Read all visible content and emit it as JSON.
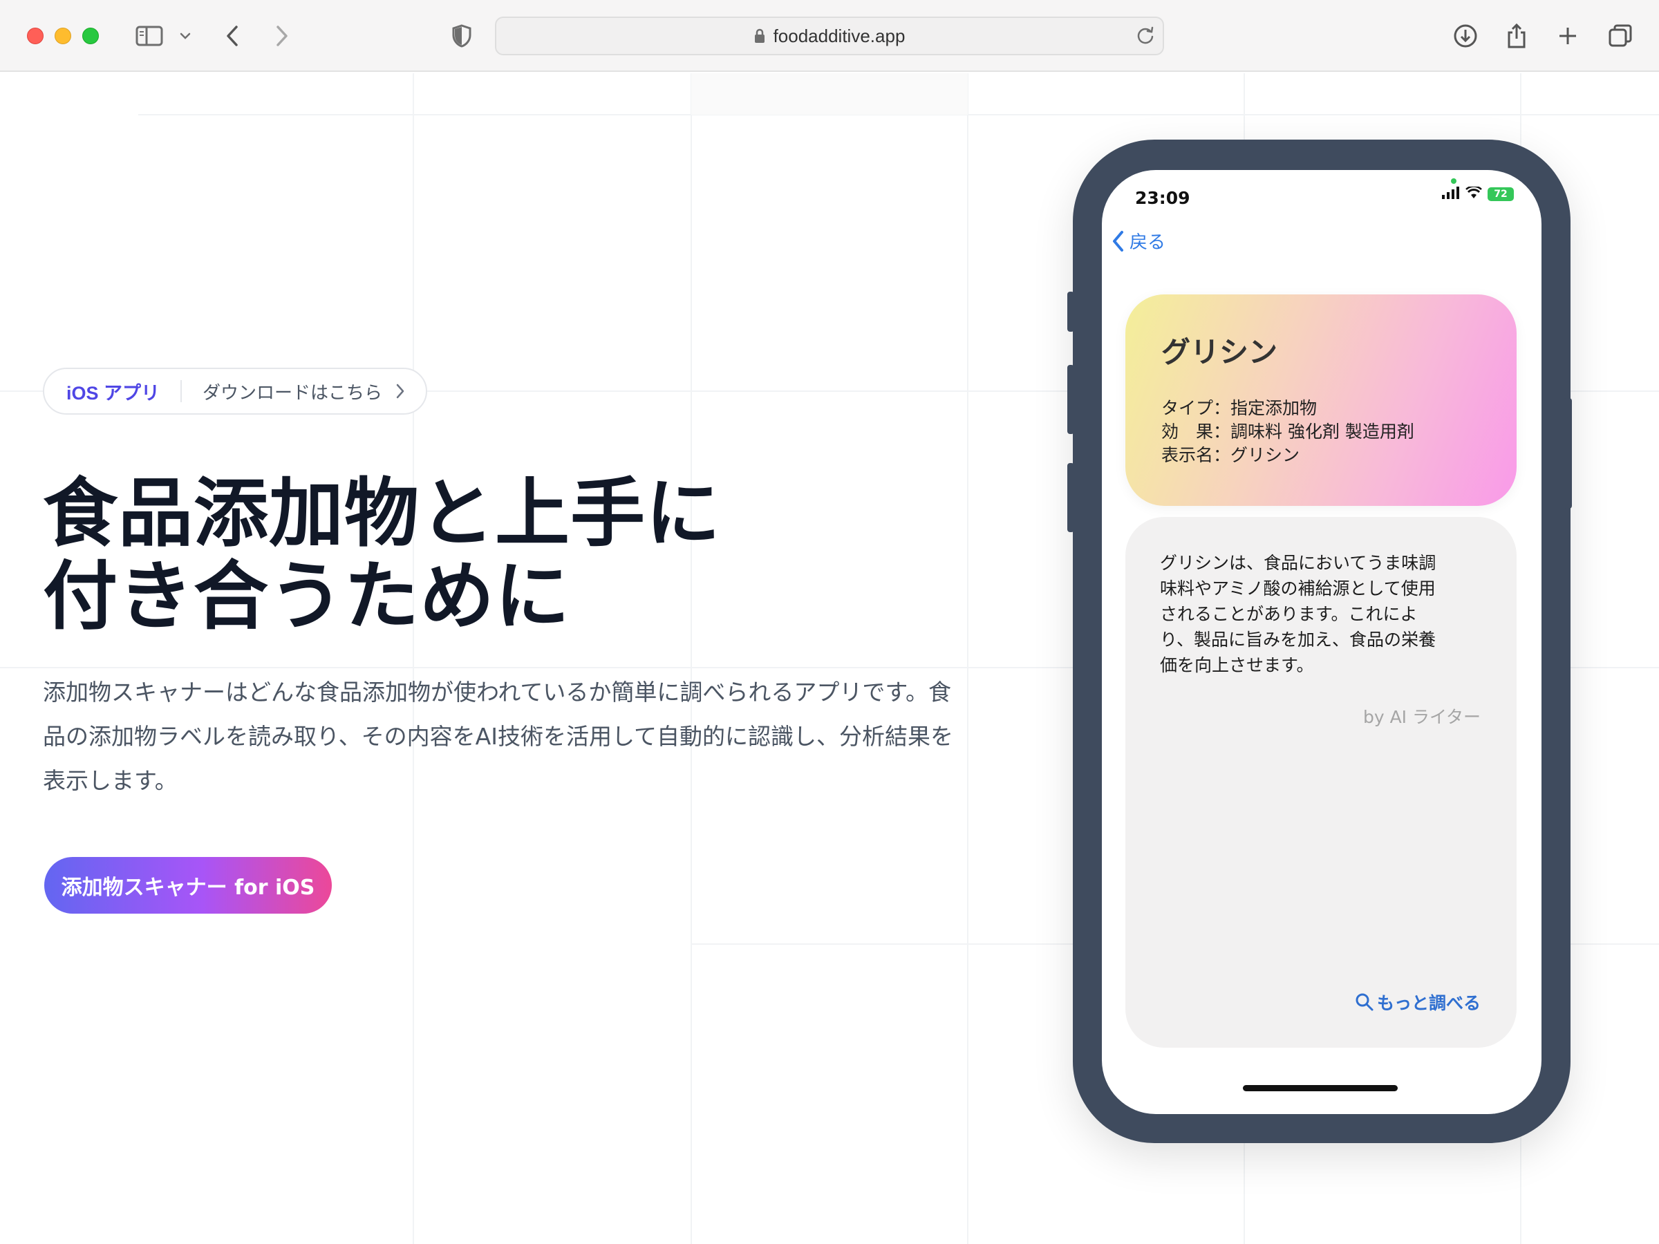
{
  "browser": {
    "url": "foodadditive.app"
  },
  "hero": {
    "pill_tag": "iOS アプリ",
    "pill_link": "ダウンロードはこちら",
    "title_line1": "食品添加物と上手に",
    "title_line2": "付き合うために",
    "desc_line1": "添加物スキャナーはどんな食品添加物が使われているか簡単に調べられるアプリです。食",
    "desc_line2": "品の添加物ラベルを読み取り、その内容をAI技術を活用して自動的に認識し、分析結果を",
    "desc_line3": "表示します。",
    "cta_label": "添加物スキャナー for iOS"
  },
  "phone": {
    "time": "23:09",
    "battery": "72",
    "back_label": "戻る",
    "card": {
      "title": "グリシン",
      "type_line": "タイプ：指定添加物",
      "effect_line": "効　果：調味料 強化剤 製造用剤",
      "display_line": "表示名：グリシン"
    },
    "description": {
      "line1": "グリシンは、食品においてうま味調",
      "line2": "味料やアミノ酸の補給源として使用",
      "line3": "されることがあります。これによ",
      "line4": "り、製品に旨みを加え、食品の栄養",
      "line5": "価を向上させます。",
      "byline": "by AI ライター",
      "more_label": "もっと調べる"
    }
  },
  "colors": {
    "accent_indigo": "#4f46e5",
    "link_blue": "#2f7ae5",
    "phone_frame": "#3f4b5e",
    "cta_start": "#6366f1",
    "cta_end": "#ec4899"
  },
  "icons": [
    "sidebar-icon",
    "chevron-down-icon",
    "back-icon",
    "forward-icon",
    "shield-icon",
    "lock-icon",
    "reload-icon",
    "download-icon",
    "share-icon",
    "plus-icon",
    "tabs-icon",
    "chevron-right-icon",
    "search-icon"
  ]
}
